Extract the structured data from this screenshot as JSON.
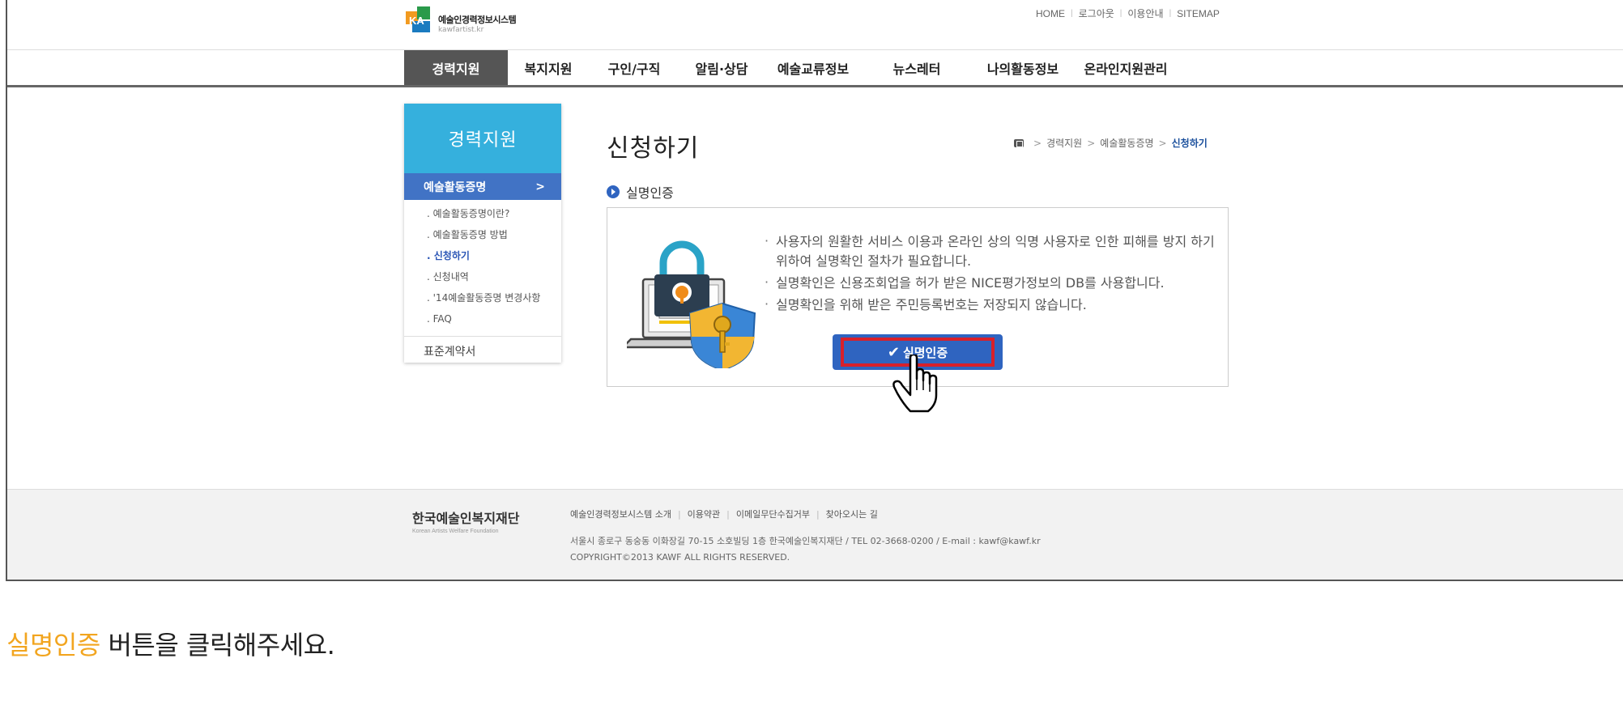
{
  "header": {
    "logo_title": "예술인경력정보시스템",
    "logo_sub": "kawfartist.kr",
    "logo_mark": "KA",
    "util_links": [
      "HOME",
      "로그아웃",
      "이용안내",
      "SITEMAP"
    ]
  },
  "nav": {
    "items": [
      {
        "label": "경력지원",
        "active": true
      },
      {
        "label": "복지지원"
      },
      {
        "label": "구인/구직"
      },
      {
        "label": "알림·상담"
      },
      {
        "label": "예술교류정보"
      },
      {
        "label": "뉴스레터"
      },
      {
        "label": "나의활동정보"
      },
      {
        "label": "온라인지원관리"
      }
    ]
  },
  "sidebar": {
    "title": "경력지원",
    "active_section": "예술활동증명",
    "active_arrow": ">",
    "sub_items": [
      {
        "label": ". 예술활동증명이란?"
      },
      {
        "label": ". 예술활동증명 방법"
      },
      {
        "label": ". 신청하기",
        "current": true
      },
      {
        "label": ". 신청내역"
      },
      {
        "label": ". '14예술활동증명 변경사항"
      },
      {
        "label": ". FAQ"
      }
    ],
    "other_item": "표준계약서"
  },
  "content": {
    "page_title": "신청하기",
    "breadcrumb": [
      "경력지원",
      "예술활동증명",
      "신청하기"
    ],
    "breadcrumb_sep": ">",
    "section_label": "실명인증",
    "notices": [
      "사용자의 원활한 서비스 이용과 온라인 상의 익명 사용자로 인한 피해를 방지 하기 위하여 실명확인 절차가 필요합니다.",
      "실명확인은 신용조회업을 허가 받은 NICE평가정보의 DB를 사용합니다.",
      "실명확인을 위해 받은 주민등록번호는 저장되지 않습니다."
    ],
    "verify_button": "실명인증",
    "verify_icon": "✔"
  },
  "footer": {
    "org_name": "한국예술인복지재단",
    "org_name_en": "Korean Artists Welfare Foundation",
    "links": [
      "예술인경력정보시스템 소개",
      "이용약관",
      "이메일무단수집거부",
      "찾아오시는 길"
    ],
    "address": "서울시 종로구 동숭동 이화장길 70-15 소호빌딩 1층 한국예술인복지재단 / TEL 02-3668-0200 / E-mail : kawf@kawf.kr",
    "copyright": "COPYRIGHT©2013 KAWF ALL RIGHTS RESERVED."
  },
  "caption": {
    "highlight": "실명인증",
    "rest": " 버튼을 클릭해주세요."
  },
  "colors": {
    "nav_active": "#555555",
    "sidebar_header": "#35b0dd",
    "sidebar_active": "#4173c5",
    "button": "#2f64c0",
    "button_highlight_border": "#d8202a",
    "caption_highlight": "#f2a51f"
  }
}
